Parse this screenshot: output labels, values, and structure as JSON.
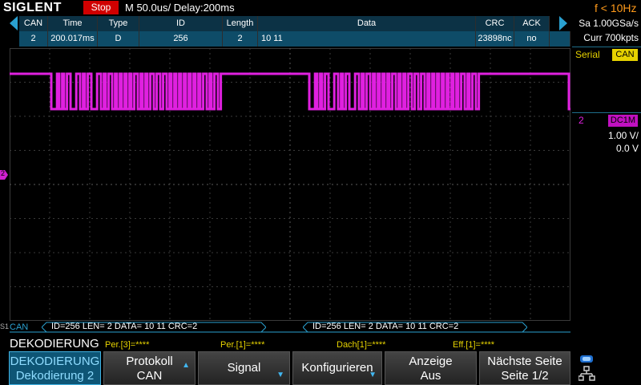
{
  "topbar": {
    "logo": "SIGLENT",
    "run_state": "Stop",
    "timebase": "M 50.0us/",
    "delay": "Delay:200ms",
    "trigger_freq": "f < 10Hz"
  },
  "decode_table": {
    "columns": [
      "CAN",
      "Time",
      "Type",
      "ID",
      "Length",
      "Data",
      "CRC",
      "ACK"
    ],
    "row": [
      "2",
      "200.017ms",
      "D",
      "256",
      "2",
      "10 11",
      "23898nc",
      "no"
    ]
  },
  "right_panel": {
    "sample_rate": "Sa 1.00GSa/s",
    "memory": "Curr 700kpts",
    "serial_label": "Serial",
    "serial_chip": "CAN",
    "ch2_number": "2",
    "ch2_coupling": "DC1M",
    "ch2_scale": "1.00 V/",
    "ch2_offset": "0.0 V"
  },
  "ch2_marker": "2",
  "bus": {
    "label": "CAN",
    "s1": "S1",
    "frame1": "ID=256  LEN=  2  DATA= 10 11     CRC=2",
    "frame2": "ID=256  LEN=  2  DATA= 10 11     CRC=2"
  },
  "menu_header": {
    "title": "DEKODIERUNG",
    "stats": [
      "Per.[3]=****",
      "Per.[1]=****",
      "Dach[1]=****",
      "Eff.[1]=****"
    ]
  },
  "softkeys": [
    {
      "line1": "DEKODIERUNG",
      "line2": "Dekodierung 2"
    },
    {
      "line1": "Protokoll",
      "line2": "CAN"
    },
    {
      "line1": "Signal",
      "line2": ""
    },
    {
      "line1": "Konfigurieren",
      "line2": ""
    },
    {
      "line1": "Anzeige",
      "line2": "Aus"
    },
    {
      "line1": "Nächste Seite",
      "line2": "Seite 1/2"
    }
  ],
  "colors": {
    "ch2": "#e020e0",
    "decode": "#2aa0d0",
    "serial": "#e6d200",
    "stop": "#d00000",
    "trigger": "#ff9a1a"
  },
  "icons": {
    "usb": "usb-icon",
    "network": "network-icon"
  }
}
